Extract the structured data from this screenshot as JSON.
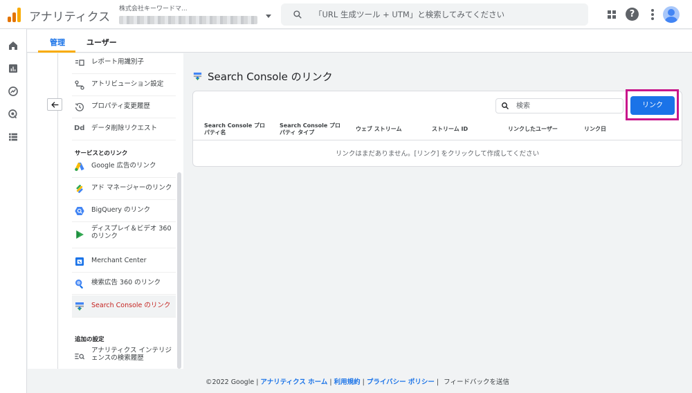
{
  "header": {
    "app_title": "アナリティクス",
    "account_name": "株式会社キーワードマ...",
    "search_placeholder": "「URL 生成ツール + UTM」と検索してみてください",
    "help_glyph": "?"
  },
  "rail": {
    "items": [
      "home-icon",
      "reports-icon",
      "explore-icon",
      "advertising-icon",
      "configure-icon"
    ],
    "settings_icon": "gear-icon"
  },
  "tabs": {
    "admin": "管理",
    "users": "ユーザー"
  },
  "nav": {
    "items": [
      {
        "label": "レポート用識別子"
      },
      {
        "label": "アトリビューション設定"
      },
      {
        "label": "プロパティ変更履歴"
      },
      {
        "label": "データ削除リクエスト"
      }
    ],
    "section_links": "サービスとのリンク",
    "links": [
      {
        "label": "Google 広告のリンク"
      },
      {
        "label": "アド マネージャーのリンク"
      },
      {
        "label": "BigQuery のリンク"
      },
      {
        "label": "ディスプレイ＆ビデオ 360 のリンク"
      },
      {
        "label": "Merchant Center"
      },
      {
        "label": "検索広告 360 のリンク"
      },
      {
        "label": "Search Console のリンク"
      }
    ],
    "section_additional": "追加の設定",
    "additional": [
      {
        "label": "アナリティクス インテリジェンスの検索履歴"
      }
    ],
    "dd_glyph": "Dd"
  },
  "main": {
    "title": "Search Console のリンク",
    "search_placeholder": "検索",
    "link_button": "リンク",
    "columns": [
      "Search Console プロパティ名",
      "Search Console プロパティ タイプ",
      "ウェブ ストリーム",
      "ストリーム ID",
      "リンクしたユーザー",
      "リンク日"
    ],
    "empty_message": "リンクはまだありません。[リンク] をクリックして作成してください"
  },
  "footer": {
    "copyright": "©2022 Google",
    "links": [
      "アナリティクス ホーム",
      "利用規約",
      "プライバシー ポリシー"
    ],
    "feedback": "フィードバックを送信"
  },
  "colors": {
    "accent": "#1a73e8",
    "brand_orange": "#f9ab00",
    "active_text": "#c5221f",
    "highlight": "#c8168b"
  }
}
